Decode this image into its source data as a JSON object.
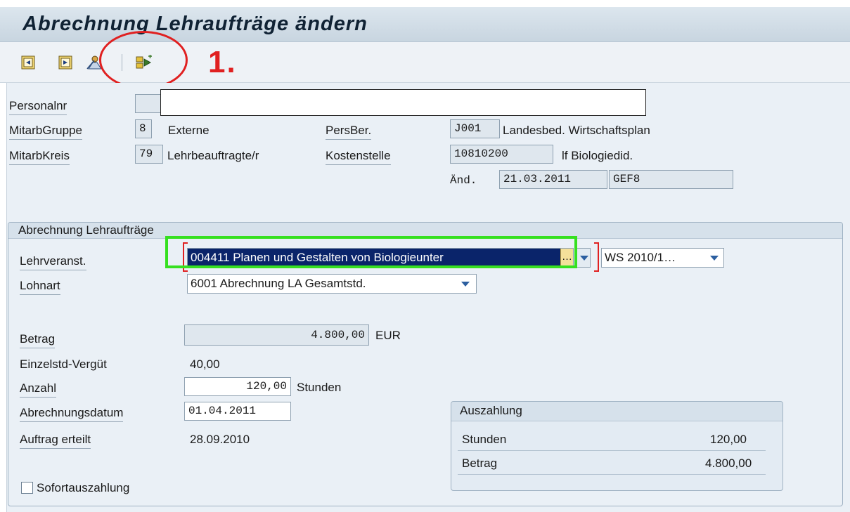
{
  "window": {
    "title": "Abrechnung Lehraufträge ändern"
  },
  "toolbar": {
    "buttons": [
      {
        "name": "previous-icon"
      },
      {
        "name": "next-icon"
      },
      {
        "name": "person-icon"
      },
      {
        "name": "execute-icon"
      }
    ]
  },
  "annotation": {
    "step_label": "1."
  },
  "header": {
    "personalnr_label": "Personalnr",
    "mitarbgruppe_label": "MitarbGruppe",
    "mitarbgruppe_code": "8",
    "mitarbgruppe_text": "Externe",
    "mitarbkreis_label": "MitarbKreis",
    "mitarbkreis_code": "79",
    "mitarbkreis_text": "Lehrbeauftragte/r",
    "persber_label": "PersBer.",
    "persber_code": "J001",
    "persber_text": "Landesbed. Wirtschaftsplan",
    "kostenstelle_label": "Kostenstelle",
    "kostenstelle_code": "10810200",
    "kostenstelle_text": "lf Biologiedid.",
    "aend_label": "Änd.",
    "aend_date": "21.03.2011",
    "aend_user": "GEF8"
  },
  "group": {
    "title": "Abrechnung Lehraufträge",
    "lehrveranst_label": "Lehrveranst.",
    "lehrveranst_value": "004411 Planen und Gestalten von Biologieunter",
    "ellipsis": "…",
    "semester_value": "WS 2010/1…",
    "lohnart_label": "Lohnart",
    "lohnart_value": "6001 Abrechnung LA Gesamtstd.",
    "betrag_label": "Betrag",
    "betrag_value": "4.800,00",
    "betrag_currency": "EUR",
    "einzelstd_label": "Einzelstd-Vergüt",
    "einzelstd_value": "40,00",
    "anzahl_label": "Anzahl",
    "anzahl_value": "120,00",
    "anzahl_unit": "Stunden",
    "abrechnungsdatum_label": "Abrechnungsdatum",
    "abrechnungsdatum_value": "01.04.2011",
    "auftrag_label": "Auftrag erteilt",
    "auftrag_value": "28.09.2010",
    "sofort_label": "Sofortauszahlung"
  },
  "auszahlung": {
    "title": "Auszahlung",
    "stunden_label": "Stunden",
    "stunden_value": "120,00",
    "betrag_label": "Betrag",
    "betrag_value": "4.800,00"
  },
  "colors": {
    "annotation_red": "#e02020",
    "highlight_green": "#36e020",
    "selection_blue": "#0a246a"
  }
}
